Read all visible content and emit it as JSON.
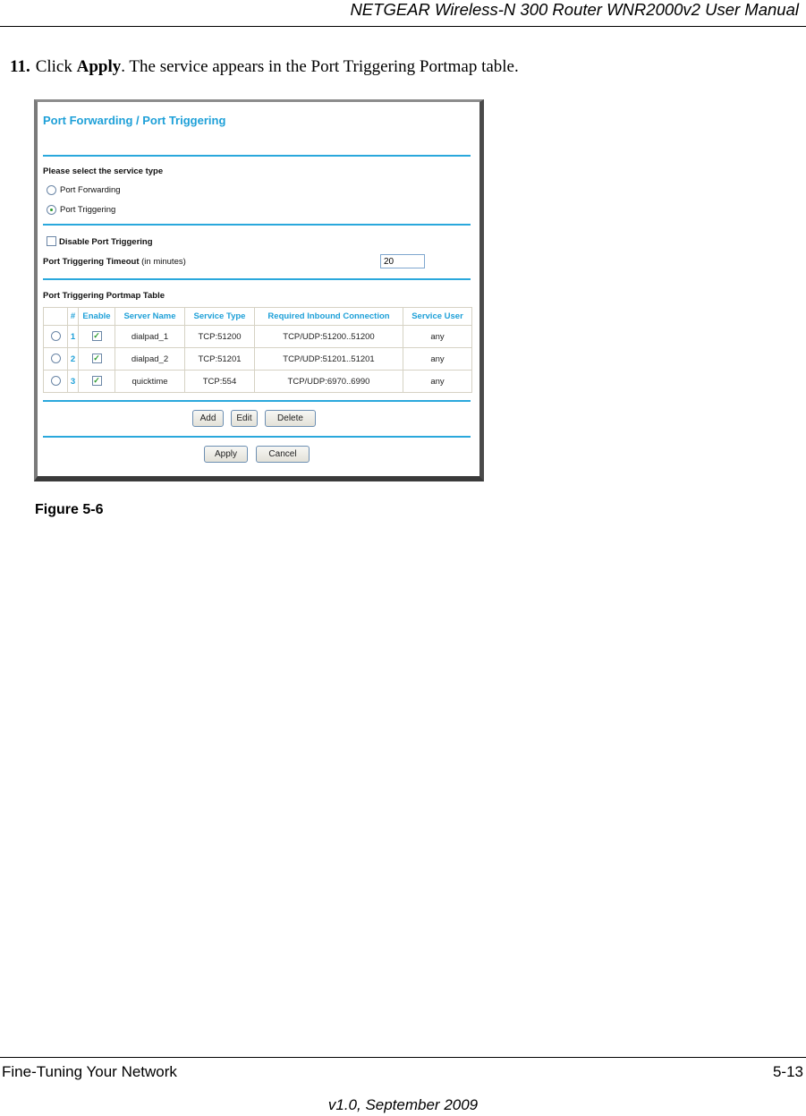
{
  "header": {
    "title": "NETGEAR Wireless-N 300 Router WNR2000v2 User Manual"
  },
  "step": {
    "number": "11.",
    "prefix": "Click ",
    "action": "Apply",
    "suffix": ". The service appears in the Port Triggering Portmap table."
  },
  "screenshot": {
    "title": "Port Forwarding / Port Triggering",
    "service_type_label": "Please select the service type",
    "service_types": [
      {
        "label": "Port Forwarding",
        "selected": false
      },
      {
        "label": "Port Triggering",
        "selected": true
      }
    ],
    "disable_label": "Disable Port Triggering",
    "disable_checked": false,
    "timeout_label_bold": "Port Triggering Timeout",
    "timeout_label_suffix": " (in minutes)",
    "timeout_value": "20",
    "table_title": "Port Triggering Portmap Table",
    "table": {
      "headers": [
        "",
        "#",
        "Enable",
        "Server Name",
        "Service Type",
        "Required Inbound Connection",
        "Service User"
      ],
      "rows": [
        {
          "num": "1",
          "enabled": true,
          "server_name": "dialpad_1",
          "service_type": "TCP:51200",
          "inbound": "TCP/UDP:51200..51200",
          "user": "any"
        },
        {
          "num": "2",
          "enabled": true,
          "server_name": "dialpad_2",
          "service_type": "TCP:51201",
          "inbound": "TCP/UDP:51201..51201",
          "user": "any"
        },
        {
          "num": "3",
          "enabled": true,
          "server_name": "quicktime",
          "service_type": "TCP:554",
          "inbound": "TCP/UDP:6970..6990",
          "user": "any"
        }
      ]
    },
    "buttons": {
      "add": "Add",
      "edit": "Edit",
      "delete": "Delete",
      "apply": "Apply",
      "cancel": "Cancel"
    },
    "colors": {
      "accent": "#1ea0d8",
      "rule": "#2aa8dc"
    }
  },
  "figure_caption": "Figure 5-6",
  "footer": {
    "section": "Fine-Tuning Your Network",
    "page": "5-13",
    "version": "v1.0, September 2009"
  }
}
